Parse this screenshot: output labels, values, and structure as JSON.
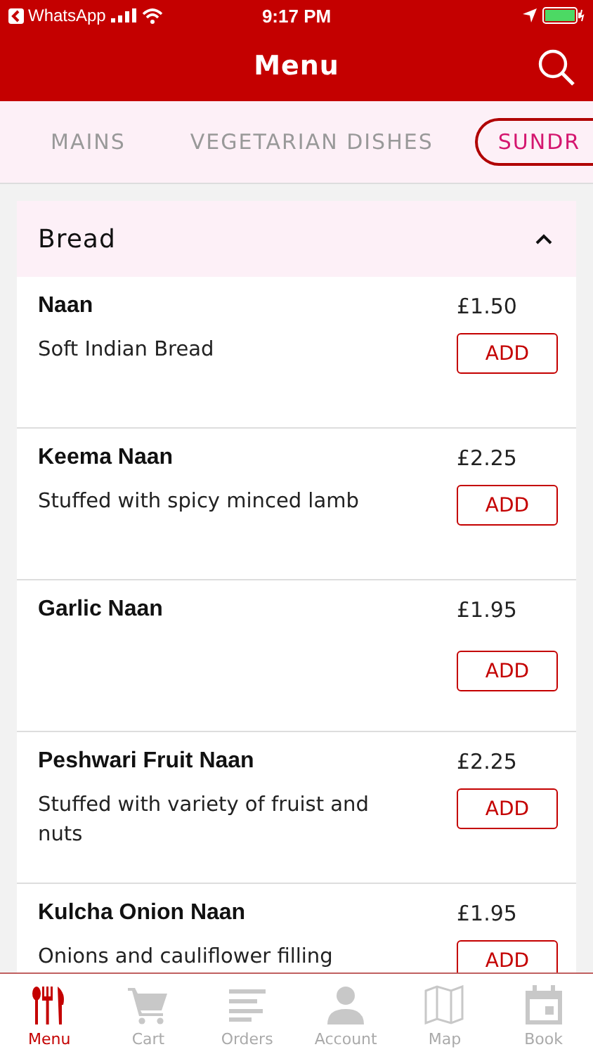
{
  "status_bar": {
    "back_label": "WhatsApp",
    "time": "9:17 PM"
  },
  "header": {
    "title": "Menu"
  },
  "tabs": [
    {
      "label": "MAINS",
      "selected": false
    },
    {
      "label": "VEGETARIAN DISHES",
      "selected": false
    },
    {
      "label": "SUNDR",
      "selected": true
    }
  ],
  "section": {
    "title": "Bread",
    "expanded": true
  },
  "items": [
    {
      "name": "Naan",
      "price": "£1.50",
      "description": "Soft Indian Bread",
      "button": "ADD"
    },
    {
      "name": "Keema Naan",
      "price": "£2.25",
      "description": "Stuffed with spicy minced lamb",
      "button": "ADD"
    },
    {
      "name": "Garlic Naan",
      "price": "£1.95",
      "button": "ADD"
    },
    {
      "name": "Peshwari Fruit Naan",
      "price": "£2.25",
      "description": "Stuffed with variety of fruist and nuts",
      "button": "ADD"
    },
    {
      "name": "Kulcha Onion Naan",
      "price": "£1.95",
      "description": "Onions and cauliflower filling",
      "button": "ADD"
    }
  ],
  "tab_bar": [
    {
      "label": "Menu",
      "selected": true
    },
    {
      "label": "Cart",
      "selected": false
    },
    {
      "label": "Orders",
      "selected": false
    },
    {
      "label": "Account",
      "selected": false
    },
    {
      "label": "Map",
      "selected": false
    },
    {
      "label": "Book",
      "selected": false
    }
  ]
}
